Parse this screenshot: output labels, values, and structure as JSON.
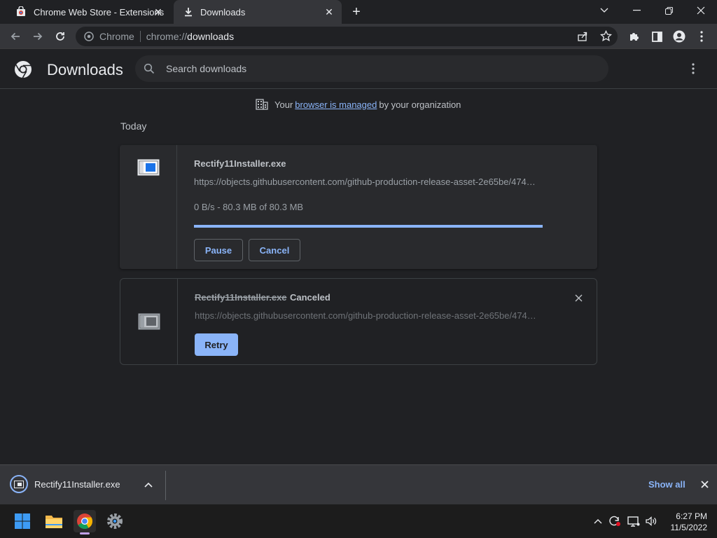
{
  "tabs": [
    {
      "title": "Chrome Web Store - Extensions",
      "icon": "chrome-web-store-icon"
    },
    {
      "title": "Downloads",
      "icon": "download-icon",
      "active": true
    }
  ],
  "omnibox": {
    "chip": "Chrome",
    "scheme": "chrome://",
    "host": "downloads"
  },
  "header": {
    "title": "Downloads",
    "search_placeholder": "Search downloads"
  },
  "managed": {
    "prefix": "Your",
    "link": "browser is managed",
    "suffix": "by your organization"
  },
  "section": {
    "label": "Today"
  },
  "downloads": [
    {
      "name": "Rectify11Installer.exe",
      "url": "https://objects.githubusercontent.com/github-production-release-asset-2e65be/474…",
      "status": "0 B/s - 80.3 MB of 80.3 MB",
      "progress": 1.0,
      "pause_label": "Pause",
      "cancel_label": "Cancel"
    },
    {
      "name": "Rectify11Installer.exe",
      "state": "Canceled",
      "url": "https://objects.githubusercontent.com/github-production-release-asset-2e65be/474…",
      "retry_label": "Retry"
    }
  ],
  "shelf": {
    "item_name": "Rectify11Installer.exe",
    "show_all": "Show all"
  },
  "taskbar": {
    "time": "6:27 PM",
    "date": "11/5/2022"
  },
  "colors": {
    "accent": "#8ab4f8",
    "background": "#202124",
    "card": "#292a2d"
  }
}
